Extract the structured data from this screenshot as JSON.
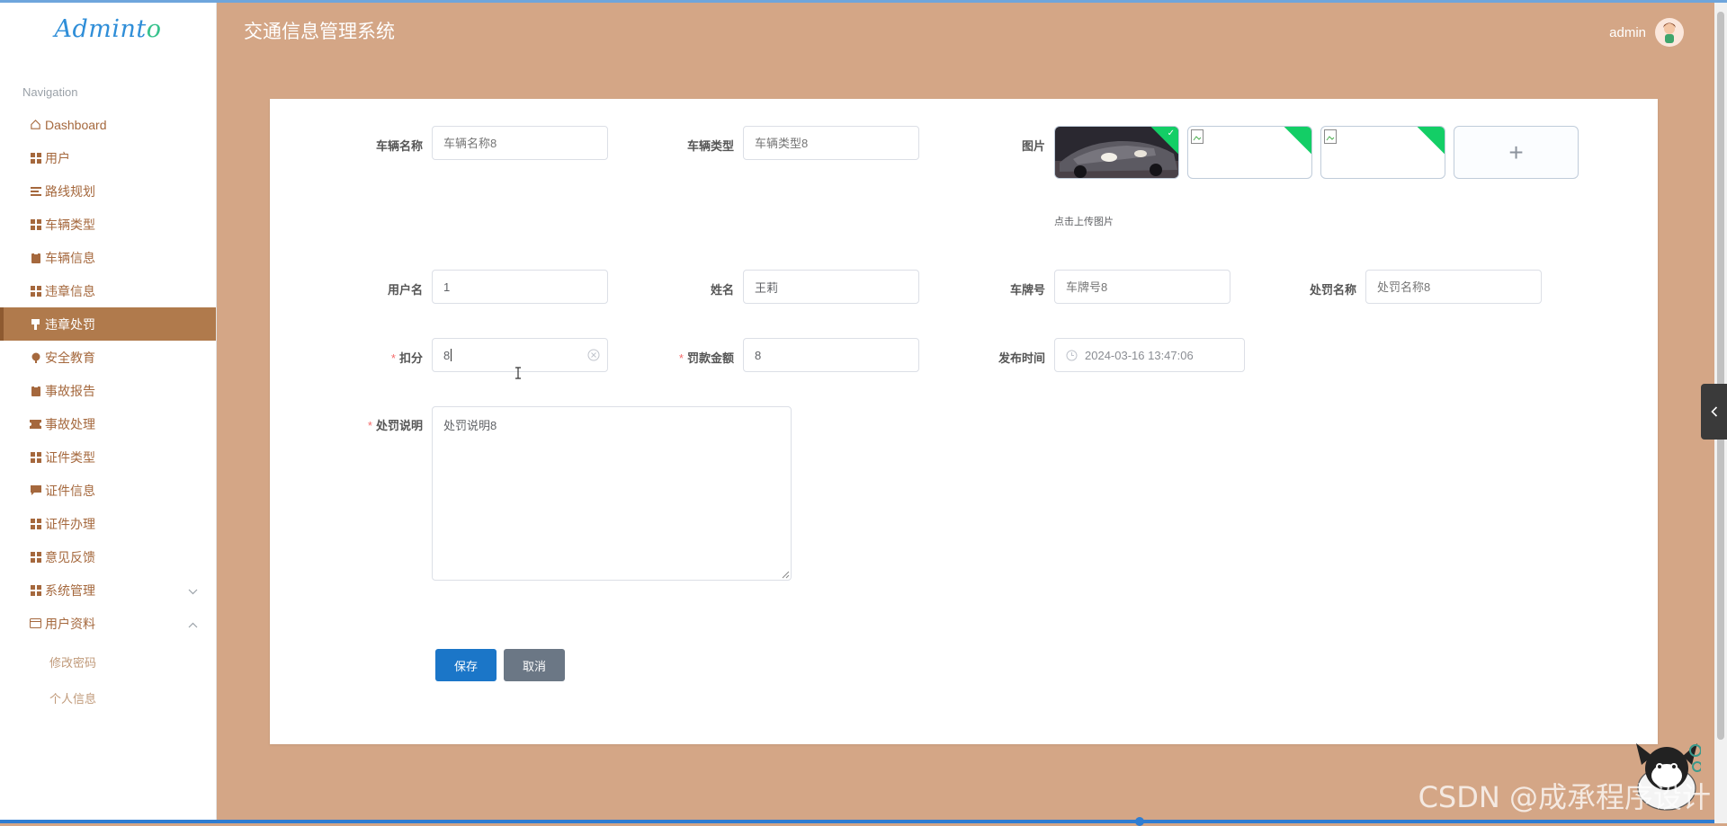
{
  "app": {
    "logo": "Adminto",
    "title": "交通信息管理系统",
    "user": "admin"
  },
  "sidebar": {
    "heading": "Navigation",
    "items": [
      {
        "label": "Dashboard",
        "icon": "home-icon"
      },
      {
        "label": "用户",
        "icon": "grid-icon"
      },
      {
        "label": "路线规划",
        "icon": "list-icon"
      },
      {
        "label": "车辆类型",
        "icon": "grid-icon"
      },
      {
        "label": "车辆信息",
        "icon": "clipboard-icon"
      },
      {
        "label": "违章信息",
        "icon": "grid-icon"
      },
      {
        "label": "违章处罚",
        "icon": "flag-icon",
        "active": true
      },
      {
        "label": "安全教育",
        "icon": "pin-icon"
      },
      {
        "label": "事故报告",
        "icon": "clipboard-icon"
      },
      {
        "label": "事故处理",
        "icon": "ticket-icon"
      },
      {
        "label": "证件类型",
        "icon": "grid-icon"
      },
      {
        "label": "证件信息",
        "icon": "chat-icon"
      },
      {
        "label": "证件办理",
        "icon": "grid-icon"
      },
      {
        "label": "意见反馈",
        "icon": "grid-icon"
      },
      {
        "label": "系统管理",
        "icon": "grid-icon"
      },
      {
        "label": "用户资料",
        "icon": "card-icon"
      }
    ],
    "sub_items": [
      "修改密码",
      "个人信息"
    ]
  },
  "form": {
    "vehicle_name": {
      "label": "车辆名称",
      "placeholder": "车辆名称8"
    },
    "vehicle_type": {
      "label": "车辆类型",
      "placeholder": "车辆类型8"
    },
    "image": {
      "label": "图片",
      "hint": "点击上传图片",
      "upload_symbol": "+"
    },
    "username": {
      "label": "用户名",
      "value": "1"
    },
    "name": {
      "label": "姓名",
      "value": "王莉"
    },
    "plate": {
      "label": "车牌号",
      "placeholder": "车牌号8"
    },
    "penalty_name": {
      "label": "处罚名称",
      "placeholder": "处罚名称8"
    },
    "points": {
      "label": "扣分",
      "value": "8",
      "required": "*"
    },
    "fine": {
      "label": "罚款金额",
      "value": "8",
      "required": "*"
    },
    "publish_time": {
      "label": "发布时间",
      "value": "2024-03-16 13:47:06"
    },
    "description": {
      "label": "处罚说明",
      "value": "处罚说明8",
      "required": "*"
    },
    "save_label": "保存",
    "cancel_label": "取消"
  },
  "watermark": "CSDN @成承程序设计",
  "colors": {
    "background": "#d4a686",
    "sidebar_active": "#b07a4c",
    "sidebar_text": "#a5683d",
    "save": "#1b76c8",
    "cancel": "#6b7785",
    "success_corner": "#13ce66"
  }
}
